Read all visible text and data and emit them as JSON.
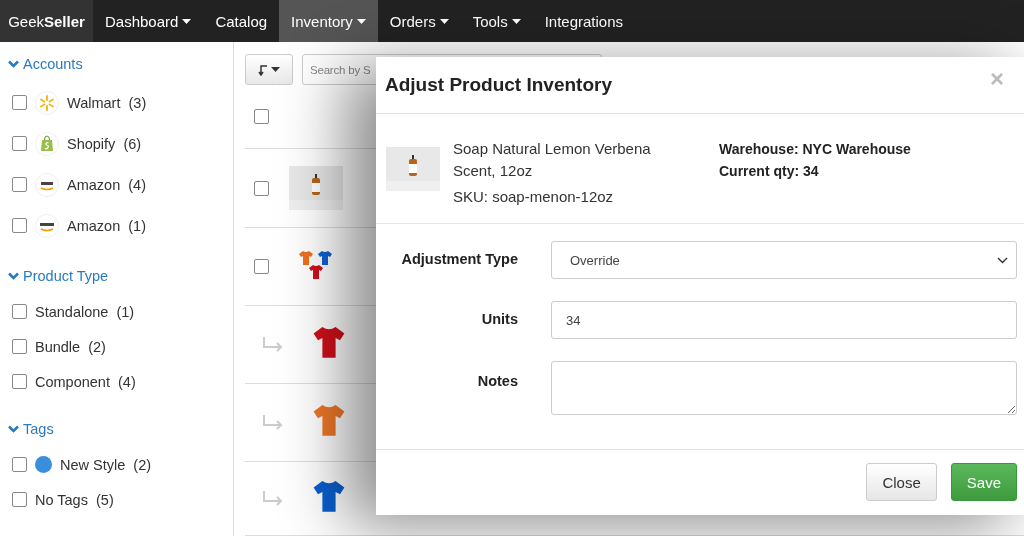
{
  "navbar": {
    "brand": {
      "light": "Geek",
      "bold": "Seller"
    },
    "items": [
      {
        "label": "Dashboard",
        "dropdown": true,
        "selected": false
      },
      {
        "label": "Catalog",
        "dropdown": false,
        "selected": false
      },
      {
        "label": "Inventory",
        "dropdown": true,
        "selected": true
      },
      {
        "label": "Orders",
        "dropdown": true,
        "selected": false
      },
      {
        "label": "Tools",
        "dropdown": true,
        "selected": false
      },
      {
        "label": "Integrations",
        "dropdown": false,
        "selected": false
      }
    ]
  },
  "sidebar": {
    "sections": [
      {
        "title": "Accounts",
        "expanded": true,
        "kind": "accounts",
        "items": [
          {
            "label": "Walmart",
            "count": "(3)",
            "checked": false
          },
          {
            "label": "Shopify",
            "count": "(6)",
            "checked": false
          },
          {
            "label": "Amazon",
            "count": "(4)",
            "checked": false
          },
          {
            "label": "Amazon",
            "count": "(1)",
            "checked": false
          }
        ]
      },
      {
        "title": "Product Type",
        "expanded": true,
        "kind": "plain",
        "items": [
          {
            "label": "Standalone",
            "count": "(1)",
            "checked": false
          },
          {
            "label": "Bundle",
            "count": "(2)",
            "checked": false
          },
          {
            "label": "Component",
            "count": "(4)",
            "checked": false
          }
        ]
      },
      {
        "title": "Tags",
        "expanded": true,
        "kind": "tags",
        "items": [
          {
            "label": "New Style",
            "count": "(2)",
            "checked": false,
            "color": "#3a8fdc"
          },
          {
            "label": "No Tags",
            "count": "(5)",
            "checked": false
          }
        ]
      }
    ]
  },
  "toolbar": {
    "search_placeholder": "Search by S"
  },
  "table": {
    "header_checked": false,
    "rows": [
      {
        "kind": "parent",
        "checked": false
      },
      {
        "kind": "parent",
        "checked": false
      },
      {
        "kind": "child"
      },
      {
        "kind": "child"
      },
      {
        "kind": "child"
      }
    ]
  },
  "modal": {
    "title": "Adjust Product Inventory",
    "close": "×",
    "product": {
      "name": "Soap Natural Lemon Verbena Scent, 12oz",
      "sku": "SKU: soap-menon-12oz",
      "warehouse": "Warehouse: NYC Warehouse",
      "current_qty": "Current qty: 34"
    },
    "fields": [
      {
        "label": "Adjustment Type",
        "kind": "select",
        "value": "Override"
      },
      {
        "label": "Units",
        "kind": "input",
        "value": "34"
      },
      {
        "label": "Notes",
        "kind": "textarea"
      }
    ],
    "buttons": [
      {
        "label": "Close",
        "kind": "default"
      },
      {
        "label": "Save",
        "kind": "primary"
      }
    ]
  }
}
